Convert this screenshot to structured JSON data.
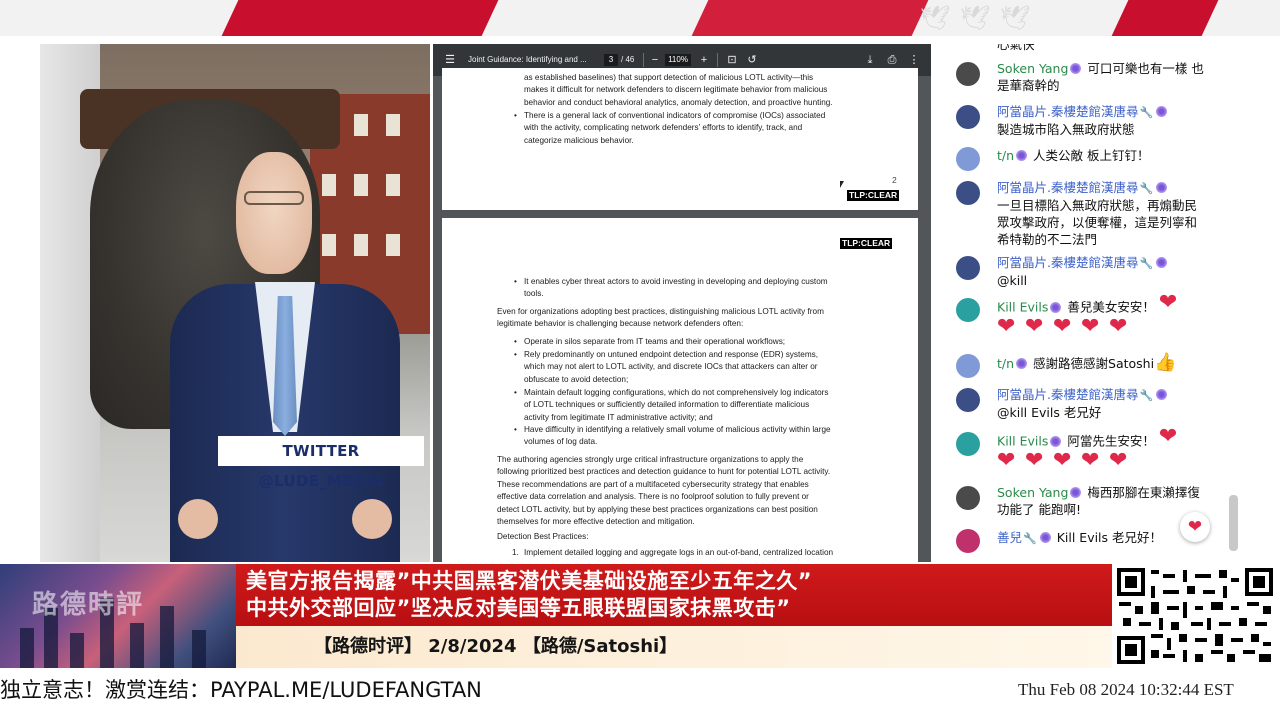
{
  "pdf": {
    "title": "Joint Guidance: Identifying and ...",
    "page_current": "3",
    "page_total": "/ 46",
    "zoom": "110%",
    "page1": {
      "lines": [
        "as established baselines) that support detection of malicious LOTL activity—this",
        "makes it difficult for network defenders to discern legitimate behavior from malicious",
        "behavior and conduct behavioral analytics, anomaly detection, and proactive hunting."
      ],
      "bullet2_lines": [
        "There is a general lack of conventional indicators of compromise (IOCs) associated",
        "with the activity, complicating network defenders’ efforts to identify, track, and",
        "categorize malicious behavior."
      ],
      "page_number": "2",
      "tlp": "TLP:CLEAR"
    },
    "page2": {
      "tlp": "TLP:CLEAR",
      "bullet_a": [
        "It enables cyber threat actors to avoid investing in developing and deploying custom",
        "tools."
      ],
      "para1": [
        "Even for organizations adopting best practices, distinguishing malicious LOTL activity from",
        "legitimate behavior is challenging because network defenders often:"
      ],
      "bullets": [
        [
          "Operate in silos separate from IT teams and their operational workflows;"
        ],
        [
          "Rely predominantly on untuned endpoint detection and response (EDR) systems,",
          "which may not alert to LOTL activity, and discrete IOCs that attackers can alter or",
          "obfuscate to avoid detection;"
        ],
        [
          "Maintain default logging configurations, which do not comprehensively log indicators",
          "of LOTL techniques or sufficiently detailed information to differentiate malicious",
          "activity from legitimate IT administrative activity; and"
        ],
        [
          "Have difficulty in identifying a relatively small volume of malicious activity within large",
          "volumes of log data."
        ]
      ],
      "para2": [
        "The authoring agencies strongly urge critical infrastructure organizations to apply the",
        "following prioritized best practices and detection guidance to hunt for potential LOTL activity.",
        "These recommendations are part of a multifaceted cybersecurity strategy that enables",
        "effective data correlation and analysis. There is no foolproof solution to fully prevent or",
        "detect LOTL activity, but by applying these best practices organizations can best position",
        "themselves for more effective detection and mitigation."
      ],
      "heading": "Detection Best Practices:",
      "numbered_1_num": "1.",
      "numbered_1": "Implement detailed logging and aggregate logs in an out-of-band, centralized location"
    }
  },
  "video": {
    "twitter_tag": "TWITTER @LUDE_MEDIA"
  },
  "chat": {
    "messages": [
      {
        "name": "",
        "text": "心氣快"
      },
      {
        "name": "Soken Yang",
        "text": "可口可樂也有一樣 也是華裔幹的"
      },
      {
        "name": "阿當晶片.秦樓楚館漢唐尋",
        "text": "製造城市陷入無政府狀態"
      },
      {
        "name": "t/n",
        "text": "人类公敵 板上钉钉！"
      },
      {
        "name": "阿當晶片.秦樓楚館漢唐尋",
        "text": "一旦目標陷入無政府狀態，再煽動民眾攻擊政府，以便奪權，這是列寧和希特勒的不二法門"
      },
      {
        "name": "阿當晶片.秦樓楚館漢唐尋",
        "text": "@kill"
      },
      {
        "name": "Kill Evils",
        "text": "善兒美女安安！"
      },
      {
        "name": "t/n",
        "text": "感謝路德感謝Satoshi"
      },
      {
        "name": "阿當晶片.秦樓楚館漢唐尋",
        "text": "@kill Evils 老兄好"
      },
      {
        "name": "Kill Evils",
        "text": "阿當先生安安！"
      },
      {
        "name": "Soken Yang",
        "text": "梅西那腳在東瀨擇復功能了 能跑啊!"
      },
      {
        "name": "善兒",
        "text": "Kill Evils 老兄好！"
      }
    ]
  },
  "lower_third": {
    "brand": "路德時評",
    "headline_1": "美官方报告揭露”中共国黑客潜伏美基础设施至少五年之久”",
    "headline_2": "中共外交部回应”坚决反对美国等五眼联盟国家抹黑攻击”",
    "subline": "【路德时评】 2/8/2024 【路德/Satoshi】"
  },
  "ticker": {
    "text": "独立意志！激赏连结：PAYPAL.ME/LUDEFANGTAN",
    "clock": "Thu Feb 08 2024 10:32:44 EST"
  },
  "colors": {
    "headline_red": "#c8102e",
    "chat_name_green": "#2a8a4a",
    "chat_name_blue": "#3f63c9",
    "pdf_toolbar": "#323639"
  }
}
